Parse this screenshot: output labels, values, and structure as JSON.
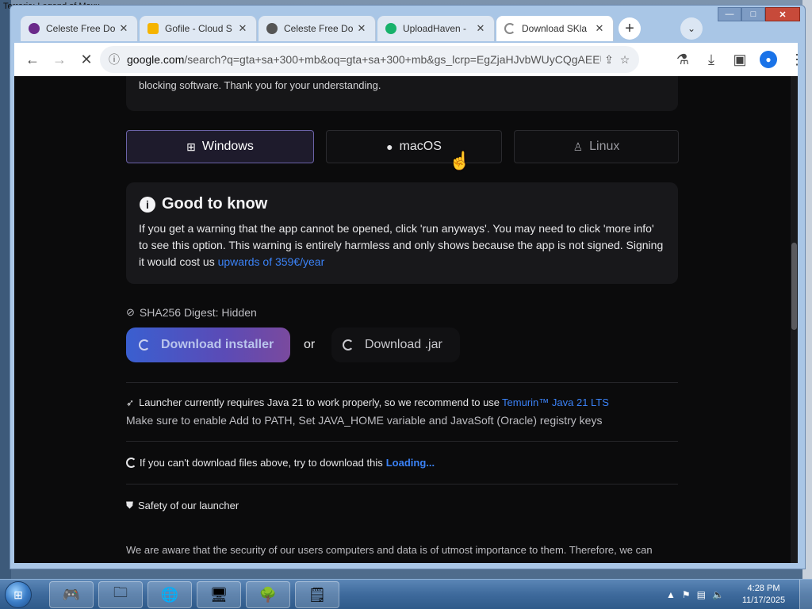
{
  "desktop": {
    "behind_window_title": "Terraria: Legend of Maxx"
  },
  "window": {
    "minimize": "—",
    "maximize": "□",
    "close": "✕"
  },
  "tabs": [
    {
      "label": "Celeste Free Do",
      "favicon_color": "#6a2a8a",
      "close": "✕"
    },
    {
      "label": "Gofile - Cloud S",
      "favicon_color": "#f5b400",
      "close": "✕"
    },
    {
      "label": "Celeste Free Do",
      "favicon_color": "#555555",
      "close": "✕"
    },
    {
      "label": "UploadHaven -",
      "favicon_color": "#18b26b",
      "close": "✕"
    },
    {
      "label": "Download SKla",
      "favicon_color": "#ffffff",
      "close": "✕"
    }
  ],
  "tabbar": {
    "new_tab": "+",
    "tab_search": "⌄"
  },
  "toolbar": {
    "back": "←",
    "forward": "→",
    "reload": "✕",
    "url_host": "google.com",
    "url_rest": "/search?q=gta+sa+300+mb&oq=gta+sa+300+mb&gs_lcrp=EgZjaHJvbWUyCQgAEEU...",
    "avatar_initial": "●"
  },
  "page": {
    "top_card_text": "blocking software. Thank you for your understanding.",
    "os_tabs": [
      {
        "label": "Windows",
        "icon": "⊞"
      },
      {
        "label": "macOS",
        "icon": ""
      },
      {
        "label": "Linux",
        "icon": "🐧"
      }
    ],
    "good_to_know": {
      "title": "Good to know",
      "body_before_link": "If you get a warning that the app cannot be opened, click 'run anyways'. You may need to click 'more info' to see this option. This warning is entirely harmless and only shows because the app is not signed. Signing it would cost us ",
      "link": "upwards of 359€/year"
    },
    "sha_line": "SHA256 Digest: Hidden",
    "download_installer": "Download installer",
    "or": "or",
    "download_jar": "Download .jar",
    "java_line_before_link": "Launcher currently requires Java 21 to work properly, so we recommend to use ",
    "java_link": "Temurin™ Java 21 LTS",
    "java_line2": "Make sure to enable Add to PATH, Set JAVA_HOME variable and JavaSoft (Oracle) registry keys",
    "fallback_text": "If you can't download files above, try to download this",
    "fallback_link": "Loading...",
    "safety_title": "Safety of our launcher",
    "security_text": "We are aware that the security of our users computers and data is of utmost importance to them. Therefore, we can"
  },
  "taskbar": {
    "time": "4:28 PM",
    "date": "11/17/2025"
  }
}
